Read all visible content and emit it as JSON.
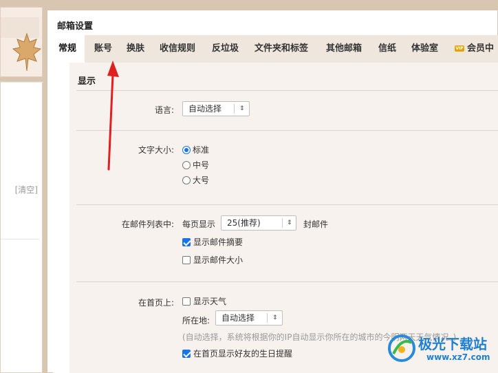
{
  "left": {
    "clear_label": "[清空]"
  },
  "main": {
    "title": "邮箱设置",
    "tabs": [
      {
        "label": "常规"
      },
      {
        "label": "账号"
      },
      {
        "label": "换肤"
      },
      {
        "label": "收信规则"
      },
      {
        "label": "反垃圾"
      },
      {
        "label": "文件夹和标签"
      },
      {
        "label": "其他邮箱"
      },
      {
        "label": "信纸"
      },
      {
        "label": "体验室"
      },
      {
        "label": "会员中"
      }
    ],
    "vip_icon_text": "VIP",
    "section_title": "显示",
    "language": {
      "label": "语言:",
      "value": "自动选择"
    },
    "font_size": {
      "label": "文字大小:",
      "options": [
        "标准",
        "中号",
        "大号"
      ],
      "selected": "标准"
    },
    "mail_list": {
      "label": "在邮件列表中:",
      "per_page_prefix": "每页显示",
      "per_page_value": "25(推荐)",
      "per_page_suffix": "封邮件",
      "show_summary": "显示邮件摘要",
      "show_size": "显示邮件大小"
    },
    "homepage": {
      "label": "在首页上:",
      "show_weather": "显示天气",
      "location_label": "所在地:",
      "location_value": "自动选择",
      "hint": "(自动选择，系统将根据你的IP自动显示你所在的城市的今明两天天气情况。)",
      "show_birthday": "在首页显示好友的生日提醒"
    }
  },
  "watermark": {
    "text": "极光下载站",
    "url": "www.xz7.com"
  },
  "colors": {
    "accent": "#1a73e8",
    "annotation": "#e02020",
    "tab_bg": "#efe6de"
  }
}
